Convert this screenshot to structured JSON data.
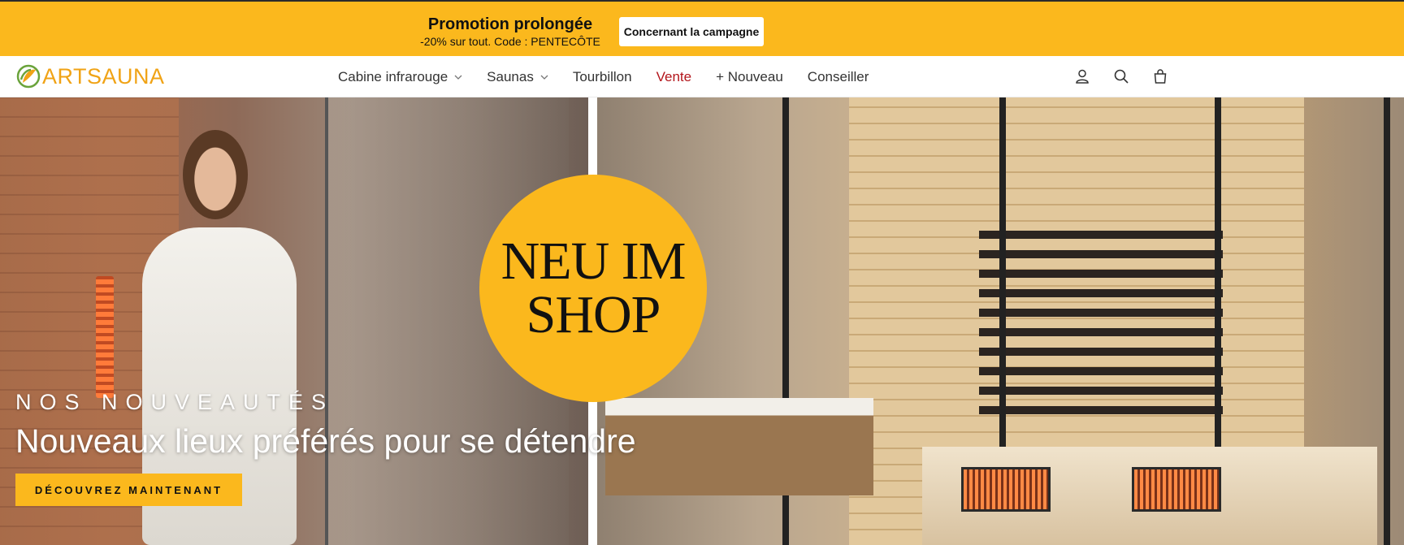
{
  "promo": {
    "title": "Promotion prolongée",
    "subtitle": "-20% sur tout. Code : PENTECÔTE",
    "button_label": "Concernant la campagne",
    "background_color": "#fbb81d"
  },
  "header": {
    "logo_text": "ARTSAUNA",
    "nav": [
      {
        "label": "Cabine infrarouge",
        "has_dropdown": true
      },
      {
        "label": "Saunas",
        "has_dropdown": true
      },
      {
        "label": "Tourbillon",
        "has_dropdown": false
      },
      {
        "label": "Vente",
        "has_dropdown": false,
        "color": "#b3151b"
      },
      {
        "label": "+ Nouveau",
        "has_dropdown": false
      },
      {
        "label": "Conseiller",
        "has_dropdown": false
      }
    ],
    "icons": [
      "user-icon",
      "search-icon",
      "cart-icon"
    ]
  },
  "hero": {
    "badge_line1": "NEU IM",
    "badge_line2": "SHOP",
    "eyebrow": "NOS NOUVEAUTÉS",
    "title": "Nouveaux lieux préférés pour se détendre",
    "cta_label": "DÉCOUVREZ MAINTENANT",
    "accent_color": "#fbb81d"
  }
}
